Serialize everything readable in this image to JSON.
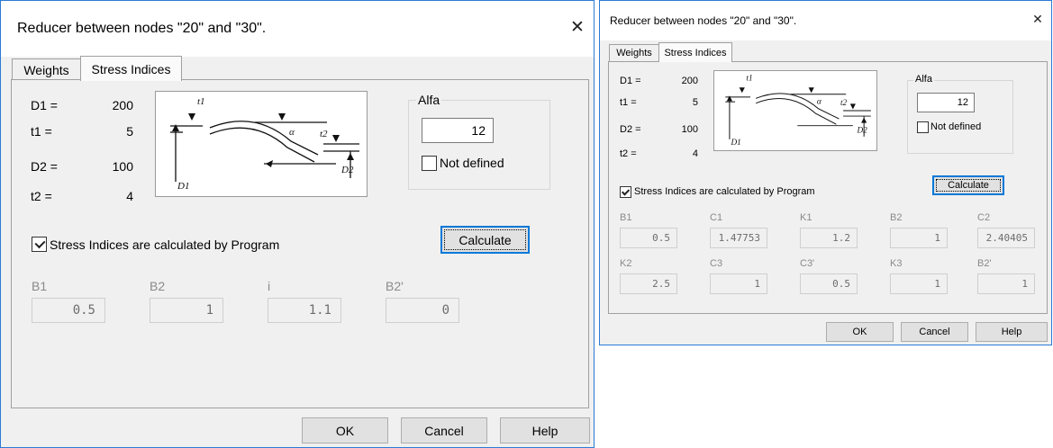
{
  "dialogs": [
    {
      "title": "Reducer between nodes \"20\" and \"30\".",
      "close_glyph": "✕",
      "tabs": [
        {
          "label": "Weights"
        },
        {
          "label": "Stress Indices"
        }
      ],
      "params": [
        {
          "label": "D1 =",
          "value": "200"
        },
        {
          "label": "t1 =",
          "value": "5"
        },
        {
          "label": "D2 =",
          "value": "100"
        },
        {
          "label": "t2 =",
          "value": "4"
        }
      ],
      "alfa": {
        "title": "Alfa",
        "value": "12",
        "not_defined_label": "Not defined",
        "not_defined_checked": false
      },
      "calc_checkbox": {
        "label": "Stress Indices are calculated by Program",
        "checked": true
      },
      "calculate_label": "Calculate",
      "indices": [
        {
          "label": "B1",
          "value": "0.5"
        },
        {
          "label": "B2",
          "value": "1"
        },
        {
          "label": "i",
          "value": "1.1"
        },
        {
          "label": "B2'",
          "value": "0"
        }
      ],
      "buttons": {
        "ok": "OK",
        "cancel": "Cancel",
        "help": "Help"
      }
    },
    {
      "title": "Reducer between nodes \"20\" and \"30\".",
      "close_glyph": "✕",
      "tabs": [
        {
          "label": "Weights"
        },
        {
          "label": "Stress Indices"
        }
      ],
      "params": [
        {
          "label": "D1 =",
          "value": "200"
        },
        {
          "label": "t1 =",
          "value": "5"
        },
        {
          "label": "D2 =",
          "value": "100"
        },
        {
          "label": "t2 =",
          "value": "4"
        }
      ],
      "alfa": {
        "title": "Alfa",
        "value": "12",
        "not_defined_label": "Not defined",
        "not_defined_checked": false
      },
      "calc_checkbox": {
        "label": "Stress Indices are calculated by Program",
        "checked": true
      },
      "calculate_label": "Calculate",
      "indices": [
        {
          "label": "B1",
          "value": "0.5"
        },
        {
          "label": "C1",
          "value": "1.47753"
        },
        {
          "label": "K1",
          "value": "1.2"
        },
        {
          "label": "B2",
          "value": "1"
        },
        {
          "label": "C2",
          "value": "2.40405"
        },
        {
          "label": "K2",
          "value": "2.5"
        },
        {
          "label": "C3",
          "value": "1"
        },
        {
          "label": "C3'",
          "value": "0.5"
        },
        {
          "label": "K3",
          "value": "1"
        },
        {
          "label": "B2'",
          "value": "1"
        }
      ],
      "buttons": {
        "ok": "OK",
        "cancel": "Cancel",
        "help": "Help"
      }
    }
  ],
  "diagram": {
    "labels": [
      "t1",
      "α",
      "t2",
      "D1",
      "D2"
    ]
  },
  "colors": {
    "accent": "#0078d7",
    "window_border": "#2a7bd5",
    "disabled_text": "#8a8a8a"
  }
}
